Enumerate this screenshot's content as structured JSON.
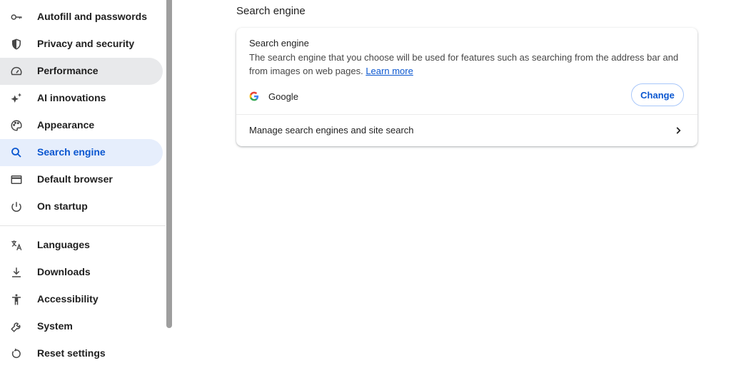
{
  "sidebar": {
    "items": [
      {
        "label": "Autofill and passwords",
        "icon": "key-icon"
      },
      {
        "label": "Privacy and security",
        "icon": "shield-icon"
      },
      {
        "label": "Performance",
        "icon": "speedometer-icon"
      },
      {
        "label": "AI innovations",
        "icon": "sparkle-icon"
      },
      {
        "label": "Appearance",
        "icon": "palette-icon"
      },
      {
        "label": "Search engine",
        "icon": "search-icon",
        "active": true
      },
      {
        "label": "Default browser",
        "icon": "browser-window-icon"
      },
      {
        "label": "On startup",
        "icon": "power-icon"
      },
      {
        "label": "Languages",
        "icon": "translate-icon"
      },
      {
        "label": "Downloads",
        "icon": "download-icon"
      },
      {
        "label": "Accessibility",
        "icon": "accessibility-icon"
      },
      {
        "label": "System",
        "icon": "wrench-icon"
      },
      {
        "label": "Reset settings",
        "icon": "reset-icon"
      }
    ]
  },
  "main": {
    "section_title": "Search engine",
    "card": {
      "heading": "Search engine",
      "description": "The search engine that you choose will be used for features such as searching from the address bar and from images on web pages.",
      "learn_more": "Learn more",
      "current_engine": "Google",
      "change_label": "Change",
      "manage_label": "Manage search engines and site search"
    }
  },
  "colors": {
    "accent": "#0b57d0",
    "active_bg": "#e6eefc",
    "hover_bg": "#e8e9eb"
  }
}
